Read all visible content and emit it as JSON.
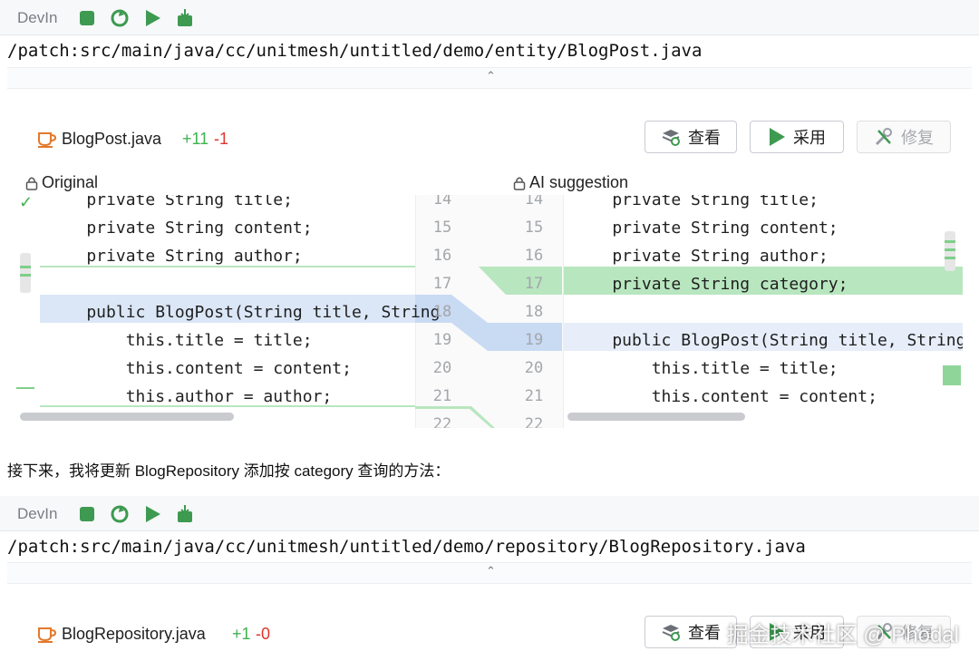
{
  "block1": {
    "lang": "DevIn",
    "path": "/patch:src/main/java/cc/unitmesh/untitled/demo/entity/BlogPost.java",
    "collapse_glyph": "⌃",
    "file_name": "BlogPost.java",
    "additions": "+11",
    "deletions": "-1",
    "buttons": {
      "view": "查看",
      "apply": "采用",
      "repair": "修复"
    },
    "left_label": "Original",
    "right_label": "AI suggestion",
    "left_lines": [
      "    private String title;",
      "    private String content;",
      "    private String author;",
      "",
      "    public BlogPost(String title, String",
      "        this.title = title;",
      "        this.content = content;",
      "        this.author = author;"
    ],
    "left_nums": [
      "14",
      "15",
      "16",
      "17",
      "18",
      "19",
      "20",
      "21",
      "22"
    ],
    "right_nums": [
      "14",
      "15",
      "16",
      "17",
      "18",
      "19",
      "20",
      "21",
      "22"
    ],
    "right_lines": [
      "    private String title;",
      "    private String content;",
      "    private String author;",
      "    private String category;",
      "",
      "    public BlogPost(String title, String",
      "        this.title = title;",
      "        this.content = content;"
    ],
    "check_glyph": "✓"
  },
  "prose": "接下来，我将更新 BlogRepository 添加按 category 查询的方法：",
  "block2": {
    "lang": "DevIn",
    "path": "/patch:src/main/java/cc/unitmesh/untitled/demo/repository/BlogRepository.java",
    "collapse_glyph": "⌃",
    "file_name": "BlogRepository.java",
    "additions": "+1",
    "deletions": "-0",
    "buttons": {
      "view": "查看",
      "apply": "采用",
      "repair": "修复"
    }
  },
  "watermark": "掘金技术社区 @ Phodal",
  "colors": {
    "added": "#b8e6bf",
    "modified": "#dbe7f7",
    "accent_green": "#3fb34f",
    "deleted_red": "#e0352b"
  }
}
